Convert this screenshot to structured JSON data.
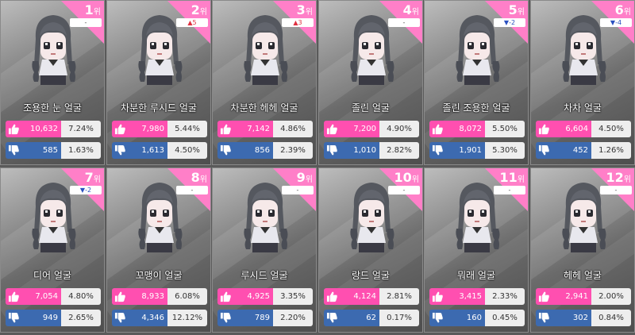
{
  "cards": [
    {
      "rank": "1",
      "rank_suffix": "위",
      "change": "-",
      "change_dir": "same",
      "name": "조용한 눈 얼굴",
      "likes": "10,632",
      "like_pct": "7.24%",
      "dislikes": "585",
      "dislike_pct": "1.63%"
    },
    {
      "rank": "2",
      "rank_suffix": "위",
      "change": "▲5",
      "change_dir": "up",
      "name": "차분한 루시드 얼굴",
      "likes": "7,980",
      "like_pct": "5.44%",
      "dislikes": "1,613",
      "dislike_pct": "4.50%"
    },
    {
      "rank": "3",
      "rank_suffix": "위",
      "change": "▲3",
      "change_dir": "up",
      "name": "차분한 헤헤 얼굴",
      "likes": "7,142",
      "like_pct": "4.86%",
      "dislikes": "856",
      "dislike_pct": "2.39%"
    },
    {
      "rank": "4",
      "rank_suffix": "위",
      "change": "-",
      "change_dir": "same",
      "name": "졸린 얼굴",
      "likes": "7,200",
      "like_pct": "4.90%",
      "dislikes": "1,010",
      "dislike_pct": "2.82%"
    },
    {
      "rank": "5",
      "rank_suffix": "위",
      "change": "▼-2",
      "change_dir": "down",
      "name": "졸린 조용한 얼굴",
      "likes": "8,072",
      "like_pct": "5.50%",
      "dislikes": "1,901",
      "dislike_pct": "5.30%"
    },
    {
      "rank": "6",
      "rank_suffix": "위",
      "change": "▼-4",
      "change_dir": "down",
      "name": "차차 얼굴",
      "likes": "6,604",
      "like_pct": "4.50%",
      "dislikes": "452",
      "dislike_pct": "1.26%"
    },
    {
      "rank": "7",
      "rank_suffix": "위",
      "change": "▼-2",
      "change_dir": "down",
      "name": "디어 얼굴",
      "likes": "7,054",
      "like_pct": "4.80%",
      "dislikes": "949",
      "dislike_pct": "2.65%"
    },
    {
      "rank": "8",
      "rank_suffix": "위",
      "change": "-",
      "change_dir": "same",
      "name": "꼬맹이 얼굴",
      "likes": "8,933",
      "like_pct": "6.08%",
      "dislikes": "4,346",
      "dislike_pct": "12.12%"
    },
    {
      "rank": "9",
      "rank_suffix": "위",
      "change": "-",
      "change_dir": "same",
      "name": "루시드 얼굴",
      "likes": "4,925",
      "like_pct": "3.35%",
      "dislikes": "789",
      "dislike_pct": "2.20%"
    },
    {
      "rank": "10",
      "rank_suffix": "위",
      "change": "-",
      "change_dir": "same",
      "name": "랑드 얼굴",
      "likes": "4,124",
      "like_pct": "2.81%",
      "dislikes": "62",
      "dislike_pct": "0.17%"
    },
    {
      "rank": "11",
      "rank_suffix": "위",
      "change": "-",
      "change_dir": "same",
      "name": "뭐래 얼굴",
      "likes": "3,415",
      "like_pct": "2.33%",
      "dislikes": "160",
      "dislike_pct": "0.45%"
    },
    {
      "rank": "12",
      "rank_suffix": "위",
      "change": "-",
      "change_dir": "same",
      "name": "헤헤 얼굴",
      "likes": "2,941",
      "like_pct": "2.00%",
      "dislikes": "302",
      "dislike_pct": "0.84%"
    }
  ],
  "colors": {
    "ribbon": "#ff7fc8",
    "like_bar": "#ff4fb0",
    "dislike_bar": "#3c6ab0",
    "up": "#e03040",
    "down": "#2a50c0"
  },
  "icons": {
    "like": "thumbs-up-icon",
    "dislike": "thumbs-down-icon"
  }
}
